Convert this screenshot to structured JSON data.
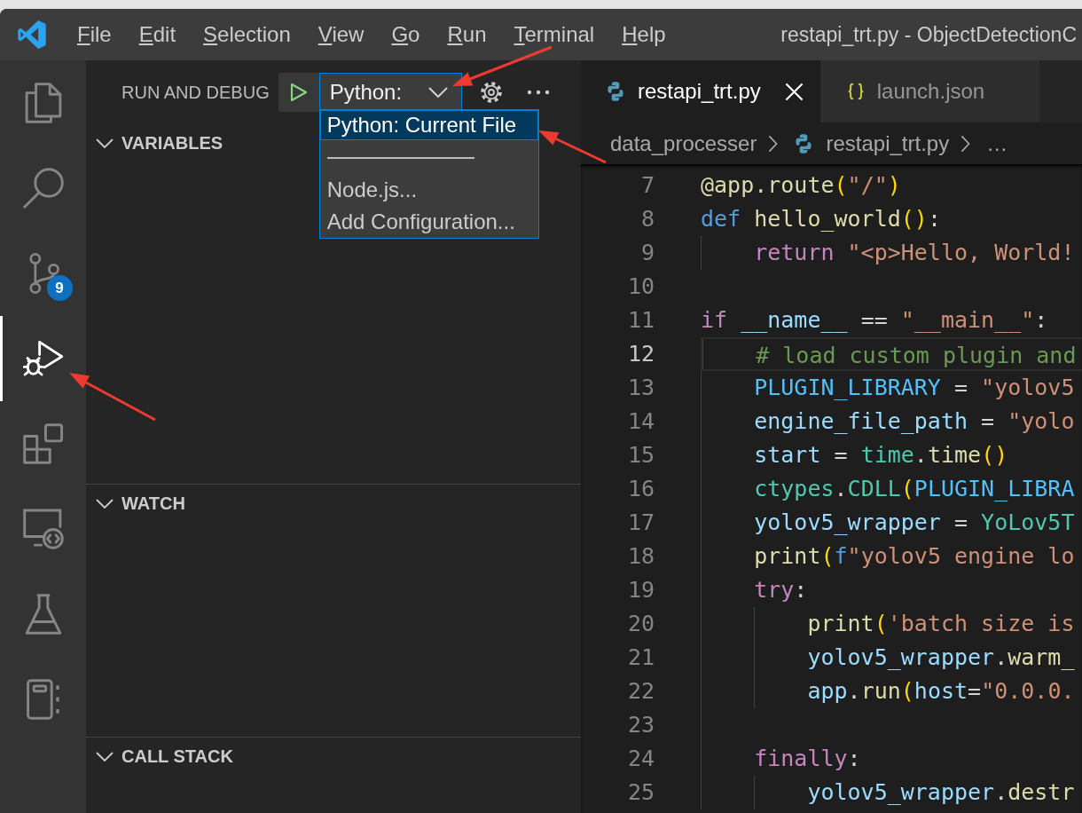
{
  "title_bar": {
    "menu": [
      "File",
      "Edit",
      "Selection",
      "View",
      "Go",
      "Run",
      "Terminal",
      "Help"
    ],
    "title": "restapi_trt.py - ObjectDetectionC"
  },
  "activity_bar": {
    "items": [
      {
        "kind": "explorer",
        "selected": false
      },
      {
        "kind": "search",
        "selected": false
      },
      {
        "kind": "source_control",
        "selected": false,
        "badge": "9"
      },
      {
        "kind": "run_debug",
        "selected": true
      },
      {
        "kind": "extensions",
        "selected": false
      },
      {
        "kind": "remote",
        "selected": false
      },
      {
        "kind": "testing",
        "selected": false
      },
      {
        "kind": "notebook",
        "selected": false
      }
    ]
  },
  "sidebar": {
    "title": "RUN AND DEBUG",
    "config": {
      "value": "Python:",
      "open": true,
      "options": [
        {
          "kind": "option",
          "label": "Python: Current File",
          "selected": true
        },
        {
          "kind": "separator"
        },
        {
          "kind": "option",
          "label": "Node.js...",
          "selected": false
        },
        {
          "kind": "option",
          "label": "Add Configuration...",
          "selected": false
        }
      ]
    },
    "sections": [
      {
        "title": "VARIABLES",
        "expanded": true
      },
      {
        "title": "WATCH",
        "expanded": true
      },
      {
        "title": "CALL STACK",
        "expanded": true
      }
    ]
  },
  "editor": {
    "tabs": [
      {
        "label": "restapi_trt.py",
        "kind": "python",
        "selected": true
      },
      {
        "label": "launch.json",
        "kind": "json",
        "selected": false
      }
    ],
    "breadcrumbs": [
      {
        "label": "data_processer",
        "kind": "folder"
      },
      {
        "label": "restapi_trt.py",
        "kind": "file"
      },
      {
        "label": "…",
        "kind": "symbols"
      }
    ],
    "lines": [
      {
        "number": "7",
        "current": false,
        "tokens": [
          {
            "text": "@app.route",
            "kind": "fn"
          },
          {
            "text": "(",
            "kind": "bracket"
          },
          {
            "text": "\"/\"",
            "kind": "str"
          },
          {
            "text": ")",
            "kind": "bracket"
          }
        ]
      },
      {
        "number": "8",
        "current": false,
        "tokens": [
          {
            "text": "def",
            "kind": "kw"
          },
          {
            "text": " hello_world",
            "kind": "fn"
          },
          {
            "text": "()",
            "kind": "bracket"
          },
          {
            "text": ":",
            "kind": "plain"
          }
        ]
      },
      {
        "number": "9",
        "current": false,
        "tokens": [
          {
            "text": "    return",
            "kind": "ctrl"
          },
          {
            "text": " \"<p>Hello, World!",
            "kind": "str"
          }
        ]
      },
      {
        "number": "10",
        "current": false
      },
      {
        "number": "11",
        "current": false,
        "tokens": [
          {
            "text": "if",
            "kind": "ctrl"
          },
          {
            "text": " __name__",
            "kind": "var"
          },
          {
            "text": " == ",
            "kind": "plain"
          },
          {
            "text": "\"__main__\"",
            "kind": "str"
          },
          {
            "text": ":",
            "kind": "plain"
          }
        ]
      },
      {
        "number": "12",
        "current": true,
        "tokens": [
          {
            "text": "    # load custom plugin and",
            "kind": "comment"
          }
        ]
      },
      {
        "number": "13",
        "current": false,
        "tokens": [
          {
            "text": "    PLUGIN_LIBRARY",
            "kind": "const"
          },
          {
            "text": " = ",
            "kind": "plain"
          },
          {
            "text": "\"yolov5",
            "kind": "str"
          }
        ]
      },
      {
        "number": "14",
        "current": false,
        "tokens": [
          {
            "text": "    engine_file_path",
            "kind": "var"
          },
          {
            "text": " = ",
            "kind": "plain"
          },
          {
            "text": "\"yolo",
            "kind": "str"
          }
        ]
      },
      {
        "number": "15",
        "current": false,
        "tokens": [
          {
            "text": "    start",
            "kind": "var"
          },
          {
            "text": " = ",
            "kind": "plain"
          },
          {
            "text": "time",
            "kind": "type"
          },
          {
            "text": ".",
            "kind": "plain"
          },
          {
            "text": "time",
            "kind": "fn"
          },
          {
            "text": "()",
            "kind": "bracket"
          }
        ]
      },
      {
        "number": "16",
        "current": false,
        "tokens": [
          {
            "text": "    ctypes",
            "kind": "type"
          },
          {
            "text": ".",
            "kind": "plain"
          },
          {
            "text": "CDLL",
            "kind": "type"
          },
          {
            "text": "(",
            "kind": "bracket"
          },
          {
            "text": "PLUGIN_LIBRA",
            "kind": "const"
          }
        ]
      },
      {
        "number": "17",
        "current": false,
        "tokens": [
          {
            "text": "    yolov5_wrapper",
            "kind": "var"
          },
          {
            "text": " = ",
            "kind": "plain"
          },
          {
            "text": "YoLov5T",
            "kind": "type"
          }
        ]
      },
      {
        "number": "18",
        "current": false,
        "tokens": [
          {
            "text": "    print",
            "kind": "fn"
          },
          {
            "text": "(",
            "kind": "bracket"
          },
          {
            "text": "f",
            "kind": "kw"
          },
          {
            "text": "\"yolov5 engine lo",
            "kind": "str"
          }
        ]
      },
      {
        "number": "19",
        "current": false,
        "tokens": [
          {
            "text": "    try",
            "kind": "ctrl"
          },
          {
            "text": ":",
            "kind": "plain"
          }
        ]
      },
      {
        "number": "20",
        "current": false,
        "tokens": [
          {
            "text": "        print",
            "kind": "fn"
          },
          {
            "text": "(",
            "kind": "bracket"
          },
          {
            "text": "'batch size is",
            "kind": "str"
          }
        ]
      },
      {
        "number": "21",
        "current": false,
        "tokens": [
          {
            "text": "        yolov5_wrapper",
            "kind": "var"
          },
          {
            "text": ".",
            "kind": "plain"
          },
          {
            "text": "warm_",
            "kind": "fn"
          }
        ]
      },
      {
        "number": "22",
        "current": false,
        "tokens": [
          {
            "text": "        app",
            "kind": "var"
          },
          {
            "text": ".",
            "kind": "plain"
          },
          {
            "text": "run",
            "kind": "fn"
          },
          {
            "text": "(",
            "kind": "bracket"
          },
          {
            "text": "host",
            "kind": "var"
          },
          {
            "text": "=",
            "kind": "plain"
          },
          {
            "text": "\"0.0.0.",
            "kind": "str"
          }
        ]
      },
      {
        "number": "23",
        "current": false
      },
      {
        "number": "24",
        "current": false,
        "tokens": [
          {
            "text": "    finally",
            "kind": "ctrl"
          },
          {
            "text": ":",
            "kind": "plain"
          }
        ]
      },
      {
        "number": "25",
        "current": false,
        "tokens": [
          {
            "text": "        yolov5_wrapper",
            "kind": "var"
          },
          {
            "text": ".",
            "kind": "plain"
          },
          {
            "text": "destr",
            "kind": "fn"
          }
        ]
      }
    ]
  }
}
